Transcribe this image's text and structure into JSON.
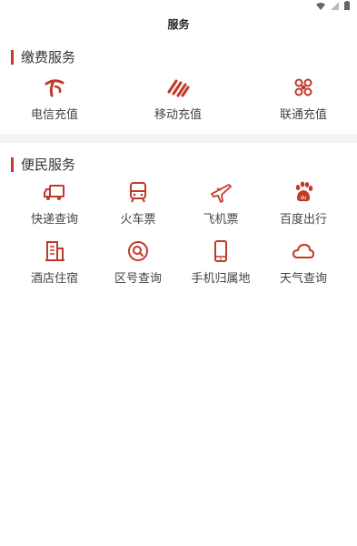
{
  "header": {
    "title": "服务"
  },
  "payment": {
    "heading": "缴费服务",
    "items": [
      {
        "label": "电信充值",
        "icon": "telecom-icon"
      },
      {
        "label": "移动充值",
        "icon": "mobile-icon"
      },
      {
        "label": "联通充值",
        "icon": "unicom-icon"
      }
    ]
  },
  "convenience": {
    "heading": "便民服务",
    "items": [
      {
        "label": "快递查询",
        "icon": "delivery-truck-icon"
      },
      {
        "label": "火车票",
        "icon": "train-icon"
      },
      {
        "label": "飞机票",
        "icon": "airplane-icon"
      },
      {
        "label": "百度出行",
        "icon": "baidu-icon"
      },
      {
        "label": "酒店住宿",
        "icon": "hotel-building-icon"
      },
      {
        "label": "区号查询",
        "icon": "search-icon"
      },
      {
        "label": "手机归属地",
        "icon": "phone-icon"
      },
      {
        "label": "天气查询",
        "icon": "cloud-icon"
      }
    ]
  },
  "colors": {
    "accent": "#c0392b",
    "divider": "#f3f3f3"
  }
}
